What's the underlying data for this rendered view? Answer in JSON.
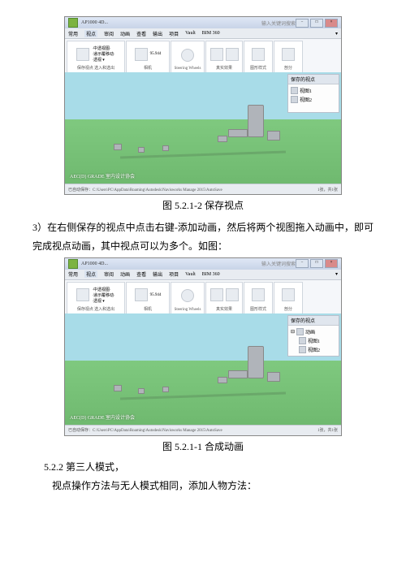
{
  "app": {
    "title_prefix": "AP1000 4D...",
    "title_search": "输入关键词搜索",
    "menu": [
      "常用",
      "视点",
      "审阅",
      "动画",
      "查看",
      "输出",
      "项目",
      "Vault",
      "BIM 360"
    ],
    "status": "已自动保存：C:\\Users\\PC\\AppData\\Roaming\\Autodesk\\Navisworks Manage 2015\\AutoSave",
    "status_right": "1张，共1张",
    "ribbon_groups": {
      "g1": "保存视点",
      "g1b": "选入和选出",
      "g2": "相机",
      "g3": "Steering Wheels",
      "g4": "真实效果",
      "g5": "图形样式",
      "g6": "剖分"
    },
    "coord": "95.944"
  },
  "panel1": {
    "header": "保存的视点",
    "items": [
      "视图1",
      "视图2"
    ]
  },
  "panel2": {
    "header": "保存的视点",
    "root": "动画",
    "items": [
      "视图1",
      "视图2"
    ]
  },
  "stamp": "AEC(D) GRADE 室内设计协会",
  "cap1": "图 5.2.1-2 保存视点",
  "para1_num": "3）",
  "para1": "在右侧保存的视点中点击右键-添加动画，然后将两个视图拖入动画中，即可完成视点动画，其中视点可以为多个。如图：",
  "cap2": "图 5.2.1-1 合成动画",
  "sec": "5.2.2 第三人模式，",
  "para2": "视点操作方法与无人模式相同，添加人物方法："
}
